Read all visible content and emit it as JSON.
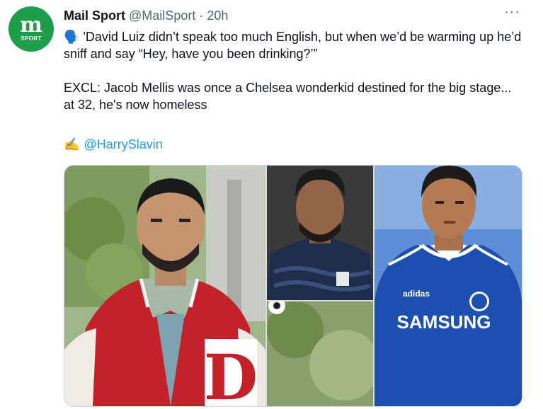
{
  "tweet": {
    "avatar": {
      "letter": "m",
      "sub": "SPORT",
      "color": "#1e9e4a"
    },
    "author_name": "Mail Sport",
    "handle": "@MailSport",
    "separator": "·",
    "time": "20h",
    "more_icon": "more-icon",
    "more_label": "···",
    "quote_emoji": "🗣️",
    "line1": "'David Luiz didn’t speak too much English, but when we’d be warming up he’d sniff and say “Hey, have you been drinking?’”",
    "line2": "EXCL: Jacob Mellis was once a Chelsea wonderkid destined for the big stage... at 32, he's now homeless",
    "credit_emoji": "✍️",
    "mention": "@HarrySlavin"
  },
  "media": {
    "images": [
      {
        "name": "photo-man-red-varsity-jacket",
        "letter": "D"
      },
      {
        "name": "photo-player-navy-kit"
      },
      {
        "name": "photo-player-chelsea-kit",
        "sponsor": "SAMSUNG",
        "brand": "adidas"
      }
    ]
  },
  "colors": {
    "accent": "#1d9bf0",
    "muted": "#536471",
    "chelsea_blue": "#1d4fb0",
    "jacket_red": "#c3222b"
  }
}
